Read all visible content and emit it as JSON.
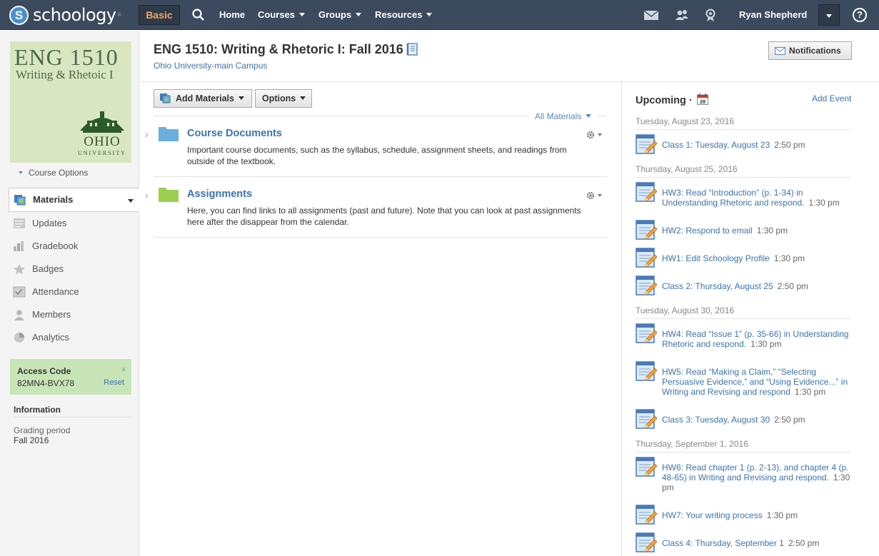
{
  "nav": {
    "logo_text": "schoology",
    "logo_mark": "S",
    "trademark": "®",
    "basic": "Basic",
    "home": "Home",
    "courses": "Courses",
    "groups": "Groups",
    "resources": "Resources",
    "user": "Ryan Shepherd",
    "help": "?"
  },
  "sidebar": {
    "pic_code": "ENG 1510",
    "pic_name": "Writing & Rhetoic I",
    "pic_ohio": "OHIO",
    "pic_univ": "UNIVERSITY",
    "course_options": "Course Options",
    "items": [
      {
        "label": "Materials",
        "icon": "materials-icon"
      },
      {
        "label": "Updates",
        "icon": "updates-icon"
      },
      {
        "label": "Gradebook",
        "icon": "gradebook-icon"
      },
      {
        "label": "Badges",
        "icon": "badges-icon"
      },
      {
        "label": "Attendance",
        "icon": "attendance-icon"
      },
      {
        "label": "Members",
        "icon": "members-icon"
      },
      {
        "label": "Analytics",
        "icon": "analytics-icon"
      }
    ],
    "access": {
      "title": "Access Code",
      "code": "82MN4-BVX78",
      "reset": "Reset",
      "close": "×"
    },
    "info": {
      "title": "Information",
      "label": "Grading period",
      "value": "Fall 2016"
    }
  },
  "main": {
    "title": "ENG 1510: Writing & Rhetoric I: Fall 2016",
    "campus": "Ohio University-main Campus",
    "notifications": "Notifications",
    "add_materials": "Add Materials",
    "options": "Options",
    "all_materials": "All Materials",
    "folders": [
      {
        "title": "Course Documents",
        "desc": "Important course documents, such as the syllabus, schedule, assignment sheets, and readings from outside of the textbook.",
        "color": "#6aaee0"
      },
      {
        "title": "Assignments",
        "desc": "Here, you can find links to all assignments (past and future). Note that you can look at past assignments here after the disappear from the calendar.",
        "color": "#9ccf4f"
      }
    ]
  },
  "upcoming": {
    "title": "Upcoming ·",
    "cal_day": "28",
    "add_event": "Add Event",
    "dates": [
      "Tuesday, August 23, 2016",
      "Thursday, August 25, 2016",
      "Tuesday, August 30, 2016",
      "Thursday, September 1, 2016"
    ],
    "events": [
      {
        "title": "Class 1: Tuesday, August 23",
        "time": "2:50 pm"
      },
      {
        "title": "HW3: Read “Introduction” (p. 1-34) in Understanding Rhetoric and respond.",
        "time": "1:30 pm"
      },
      {
        "title": "HW2: Respond to email",
        "time": "1:30 pm"
      },
      {
        "title": "HW1: Edit Schoology Profile",
        "time": "1:30 pm"
      },
      {
        "title": "Class 2: Thursday, August 25",
        "time": "2:50 pm"
      },
      {
        "title": "HW4: Read “Issue 1” (p. 35-66) in Understanding Rhetoric and respond.",
        "time": "1:30 pm"
      },
      {
        "title": "HW5: Read “Making a Claim,” “Selecting Persuasive Evidence,” and “Using Evidence...” in Writing and Revising and respond",
        "time": "1:30 pm"
      },
      {
        "title": "Class 3: Tuesday, August 30",
        "time": "2:50 pm"
      },
      {
        "title": "HW6: Read chapter 1 (p. 2-13), and chapter 4 (p. 48-65) in Writing and Revising and respond.",
        "time": "1:30 pm"
      },
      {
        "title": "HW7: Your writing process",
        "time": "1:30 pm"
      },
      {
        "title": "Class 4: Thursday, September 1",
        "time": "2:50 pm"
      }
    ]
  }
}
